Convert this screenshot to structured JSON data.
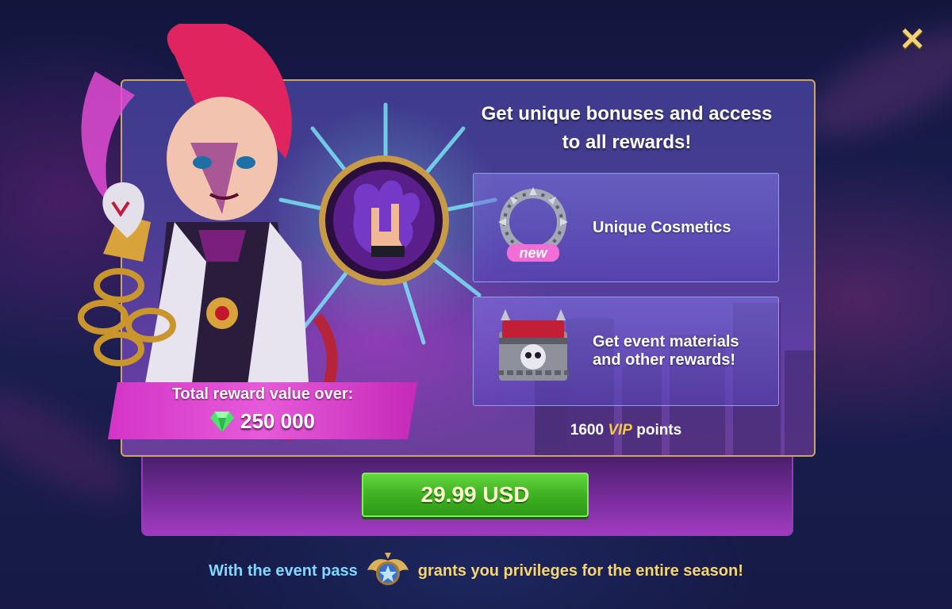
{
  "close": {
    "icon": "close-icon",
    "glyph": "✕"
  },
  "offer": {
    "headline_line1": "Get unique bonuses and access",
    "headline_line2": "to all rewards!",
    "features": [
      {
        "icon": "cosmetic-ring-icon",
        "badge": "new",
        "label": "Unique Cosmetics"
      },
      {
        "icon": "skull-chest-icon",
        "label_line1": "Get event materials",
        "label_line2": "and other rewards!"
      }
    ],
    "vip_points": "1600",
    "vip_word": "VIP",
    "vip_suffix": "points"
  },
  "reward_banner": {
    "label": "Total reward value over:",
    "gem_icon": "gem-icon",
    "value": "250 000"
  },
  "purchase": {
    "price_label": "29.99 USD"
  },
  "footer": {
    "text_before": "With the event pass",
    "badge_icon": "event-pass-badge-icon",
    "text_after": "grants you privileges for the entire season!"
  },
  "colors": {
    "accent_gold": "#f4c94a",
    "button_green": "#3fb123",
    "banner_pink": "#e65ad9",
    "footer_blue": "#7fd8ff"
  }
}
